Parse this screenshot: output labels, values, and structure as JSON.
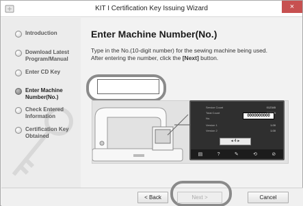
{
  "window": {
    "title": "KIT I Certification Key Issuing Wizard",
    "close_glyph": "×"
  },
  "sidebar": {
    "steps": [
      {
        "label": "Introduction",
        "active": false
      },
      {
        "label": "Download Latest Program/Manual",
        "active": false
      },
      {
        "label": "Enter CD Key",
        "active": false
      },
      {
        "label": "Enter Machine Number(No.)",
        "active": true
      },
      {
        "label": "Check Entered Information",
        "active": false
      },
      {
        "label": "Certification Key Obtained",
        "active": false
      }
    ]
  },
  "main": {
    "heading": "Enter Machine Number(No.)",
    "instruction_line1": "Type in the No.(10-digit number) for the sewing machine being used.",
    "instruction_line2_prefix": "After entering the number, click the ",
    "instruction_line2_bold": "[Next]",
    "instruction_line2_suffix": " button.",
    "machine_number_value": ""
  },
  "illustration": {
    "screen_rows": [
      {
        "label": "Service Count",
        "value": "012345"
      },
      {
        "label": "Total Count",
        "value": "012345"
      },
      {
        "label": "No.",
        "value": ""
      },
      {
        "label": "Version 1",
        "value": "1.00"
      },
      {
        "label": "Version 2",
        "value": "1.00"
      }
    ],
    "number_box": "0000000000",
    "nav_text": "◂ 4 ▸",
    "bottom_glyphs": [
      "▤",
      "?",
      "✎",
      "⟲",
      "⊘"
    ]
  },
  "footer": {
    "back_label": "< Back",
    "next_label": "Next >",
    "cancel_label": "Cancel"
  },
  "colors": {
    "close_bg": "#c75050",
    "highlight_ring": "#8a8a8a"
  }
}
